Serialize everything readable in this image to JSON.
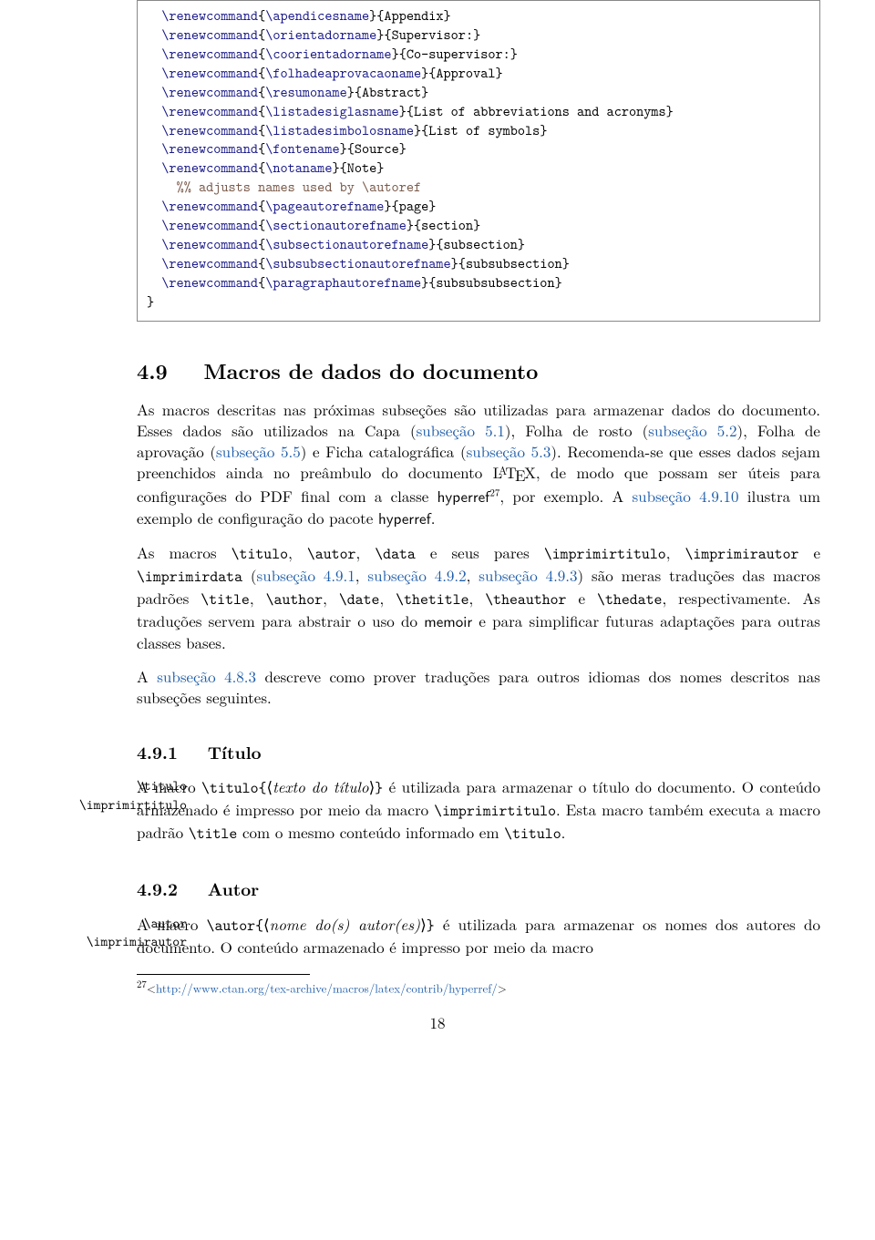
{
  "code": {
    "lines": [
      {
        "indent": 1,
        "parts": [
          {
            "t": "cmd",
            "v": "\\renewcommand"
          },
          {
            "t": "text",
            "v": "{"
          },
          {
            "t": "cmd",
            "v": "\\apendicesname"
          },
          {
            "t": "text",
            "v": "}{Appendix}"
          }
        ]
      },
      {
        "indent": 1,
        "parts": [
          {
            "t": "cmd",
            "v": "\\renewcommand"
          },
          {
            "t": "text",
            "v": "{"
          },
          {
            "t": "cmd",
            "v": "\\orientadorname"
          },
          {
            "t": "text",
            "v": "}{Supervisor:}"
          }
        ]
      },
      {
        "indent": 1,
        "parts": [
          {
            "t": "cmd",
            "v": "\\renewcommand"
          },
          {
            "t": "text",
            "v": "{"
          },
          {
            "t": "cmd",
            "v": "\\coorientadorname"
          },
          {
            "t": "text",
            "v": "}{Co-supervisor:}"
          }
        ]
      },
      {
        "indent": 1,
        "parts": [
          {
            "t": "cmd",
            "v": "\\renewcommand"
          },
          {
            "t": "text",
            "v": "{"
          },
          {
            "t": "cmd",
            "v": "\\folhadeaprovacaoname"
          },
          {
            "t": "text",
            "v": "}{Approval}"
          }
        ]
      },
      {
        "indent": 1,
        "parts": [
          {
            "t": "cmd",
            "v": "\\renewcommand"
          },
          {
            "t": "text",
            "v": "{"
          },
          {
            "t": "cmd",
            "v": "\\resumoname"
          },
          {
            "t": "text",
            "v": "}{Abstract}"
          }
        ]
      },
      {
        "indent": 1,
        "parts": [
          {
            "t": "cmd",
            "v": "\\renewcommand"
          },
          {
            "t": "text",
            "v": "{"
          },
          {
            "t": "cmd",
            "v": "\\listadesiglasname"
          },
          {
            "t": "text",
            "v": "}{List of abbreviations and acronyms}"
          }
        ]
      },
      {
        "indent": 1,
        "parts": [
          {
            "t": "cmd",
            "v": "\\renewcommand"
          },
          {
            "t": "text",
            "v": "{"
          },
          {
            "t": "cmd",
            "v": "\\listadesimbolosname"
          },
          {
            "t": "text",
            "v": "}{List of symbols}"
          }
        ]
      },
      {
        "indent": 1,
        "parts": [
          {
            "t": "cmd",
            "v": "\\renewcommand"
          },
          {
            "t": "text",
            "v": "{"
          },
          {
            "t": "cmd",
            "v": "\\fontename"
          },
          {
            "t": "text",
            "v": "}{Source}"
          }
        ]
      },
      {
        "indent": 1,
        "parts": [
          {
            "t": "cmd",
            "v": "\\renewcommand"
          },
          {
            "t": "text",
            "v": "{"
          },
          {
            "t": "cmd",
            "v": "\\notaname"
          },
          {
            "t": "text",
            "v": "}{Note}"
          }
        ]
      },
      {
        "indent": 2,
        "parts": [
          {
            "t": "comment",
            "v": "%% adjusts names used by \\autoref"
          }
        ]
      },
      {
        "indent": 1,
        "parts": [
          {
            "t": "cmd",
            "v": "\\renewcommand"
          },
          {
            "t": "text",
            "v": "{"
          },
          {
            "t": "cmd",
            "v": "\\pageautorefname"
          },
          {
            "t": "text",
            "v": "}{page}"
          }
        ]
      },
      {
        "indent": 1,
        "parts": [
          {
            "t": "cmd",
            "v": "\\renewcommand"
          },
          {
            "t": "text",
            "v": "{"
          },
          {
            "t": "cmd",
            "v": "\\sectionautorefname"
          },
          {
            "t": "text",
            "v": "}{section}"
          }
        ]
      },
      {
        "indent": 1,
        "parts": [
          {
            "t": "cmd",
            "v": "\\renewcommand"
          },
          {
            "t": "text",
            "v": "{"
          },
          {
            "t": "cmd",
            "v": "\\subsectionautorefname"
          },
          {
            "t": "text",
            "v": "}{subsection}"
          }
        ]
      },
      {
        "indent": 1,
        "parts": [
          {
            "t": "cmd",
            "v": "\\renewcommand"
          },
          {
            "t": "text",
            "v": "{"
          },
          {
            "t": "cmd",
            "v": "\\subsubsectionautorefname"
          },
          {
            "t": "text",
            "v": "}{subsubsection}"
          }
        ]
      },
      {
        "indent": 1,
        "parts": [
          {
            "t": "cmd",
            "v": "\\renewcommand"
          },
          {
            "t": "text",
            "v": "{"
          },
          {
            "t": "cmd",
            "v": "\\paragraphautorefname"
          },
          {
            "t": "text",
            "v": "}{subsubsubsection}"
          }
        ]
      },
      {
        "indent": 0,
        "parts": [
          {
            "t": "text",
            "v": "}"
          }
        ]
      }
    ]
  },
  "section49": {
    "num": "4.9",
    "title": "Macros de dados do documento"
  },
  "p1": {
    "t1": "As macros descritas nas próximas subseções são utilizadas para armazenar dados do documento. Esses dados são utilizados na Capa (",
    "l1": "subseção 5.1",
    "t2": "), Folha de rosto (",
    "l2": "subseção 5.2",
    "t3": "), Folha de aprovação (",
    "l3": "subseção 5.5",
    "t4": ") e Ficha catalográfica (",
    "l4": "subseção 5.3",
    "t4b": "). Recomenda-se que esses dados sejam preenchidos ainda no preâmbulo do documento L",
    "latex_a": "A",
    "latex_tex": "T",
    "latex_e": "E",
    "latex_x": "X",
    "t5": ", de modo que possam ser úteis para configurações do PDF final com a classe ",
    "sf1": "hyperref",
    "fn27": "27",
    "t6": ", por exemplo. A ",
    "l5": "subseção 4.9.10",
    "t7": " ilustra um exemplo de configuração do pacote ",
    "sf2": "hyperref",
    "t8": "."
  },
  "p2": {
    "t1": "As macros ",
    "c1": "\\titulo",
    "t2": ", ",
    "c2": "\\autor",
    "t3": ", ",
    "c3": "\\data",
    "t4": " e seus pares ",
    "c4": "\\imprimirtitulo",
    "t5": ", ",
    "c5": "\\imprimirautor",
    "t6": " e ",
    "c6": "\\imprimirdata",
    "t7": " (",
    "l1": "subseção 4.9.1",
    "t8": ", ",
    "l2": "subseção 4.9.2",
    "t9": ", ",
    "l3": "subseção 4.9.3",
    "t10": ") são meras traduções das macros padrões ",
    "c7": "\\title",
    "t11": ", ",
    "c8": "\\author",
    "t12": ", ",
    "c9": "\\date",
    "t13": ", ",
    "c10": "\\thetitle",
    "t14": ", ",
    "c11": "\\theauthor",
    "t15": " e ",
    "c12": "\\thedate",
    "t16": ", respectivamente. As traduções servem para abstrair o uso do ",
    "sf1": "memoir",
    "t17": " e para simplificar futuras adaptações para outras classes bases."
  },
  "p3": {
    "t1": "A ",
    "l1": "subseção 4.8.3",
    "t2": " descreve como prover traduções para outros idiomas dos nomes descritos nas subseções seguintes."
  },
  "sub491": {
    "num": "4.9.1",
    "title": "Título",
    "margin1": "\\titulo",
    "margin2": "\\imprimirtitulo"
  },
  "p491": {
    "t1": "A macro ",
    "c1": "\\titulo{",
    "arg1_open": "⟨",
    "arg1": "texto do título",
    "arg1_close": "⟩",
    "c1b": "}",
    "t2": " é utilizada para armazenar o título do documento. O conteúdo armazenado é impresso por meio da macro ",
    "c2": "\\imprimirtitulo",
    "t3": ". Esta macro também executa a macro padrão ",
    "c3": "\\title",
    "t4": " com o mesmo conteúdo informado em ",
    "c4": "\\titulo",
    "t5": "."
  },
  "sub492": {
    "num": "4.9.2",
    "title": "Autor",
    "margin1": "\\autor",
    "margin2": "\\imprimirautor"
  },
  "p492": {
    "t1": "A macro ",
    "c1": "\\autor{",
    "arg1_open": "⟨",
    "arg1": "nome do(s) autor(es)",
    "arg1_close": "⟩",
    "c1b": "}",
    "t2": " é utilizada para armazenar os nomes dos autores do documento. O conteúdo armazenado é impresso por meio da macro"
  },
  "footnote": {
    "num": "27",
    "open": "<",
    "url": "http://www.ctan.org/tex-archive/macros/latex/contrib/hyperref/",
    "close": ">"
  },
  "pagenum": "18"
}
